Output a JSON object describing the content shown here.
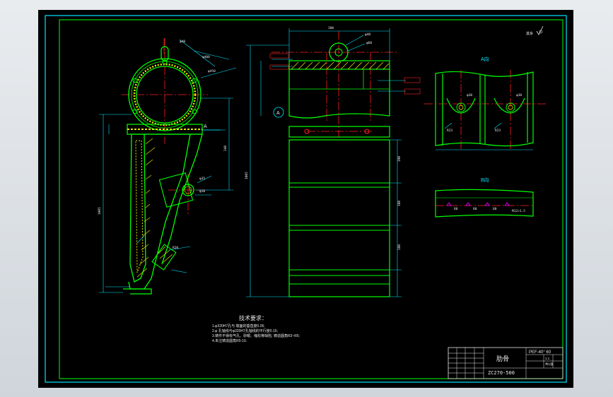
{
  "view_labels": {
    "section_a": "A",
    "view_a": "A向",
    "view_b": "B向",
    "roughness": "其余"
  },
  "notes": {
    "heading": "技术要求：",
    "items": [
      "1.φ320H7孔与 端面的垂直度0.05;",
      "2.φ 孔轴线与φ320H7孔轴线的平行度0.15;",
      "3.铸件不得有气孔、砂眼、缩松等缺陷, 铸造圆角R3~R5;",
      "4.未注铸造圆角R5-10."
    ]
  },
  "title_block": {
    "part_name": "肋骨",
    "drawing_no": "ZC270-500",
    "material": "PEF-40° 60",
    "scale": "1:1",
    "sheet": "共1张"
  },
  "colors": {
    "outline": "#00ff00",
    "dimension": "#00e5ff",
    "centerline": "#ff2020",
    "hatch": "#e6e600",
    "border": "#00e5ff",
    "marker": "#ff00ff",
    "text": "#e8e8e8"
  }
}
